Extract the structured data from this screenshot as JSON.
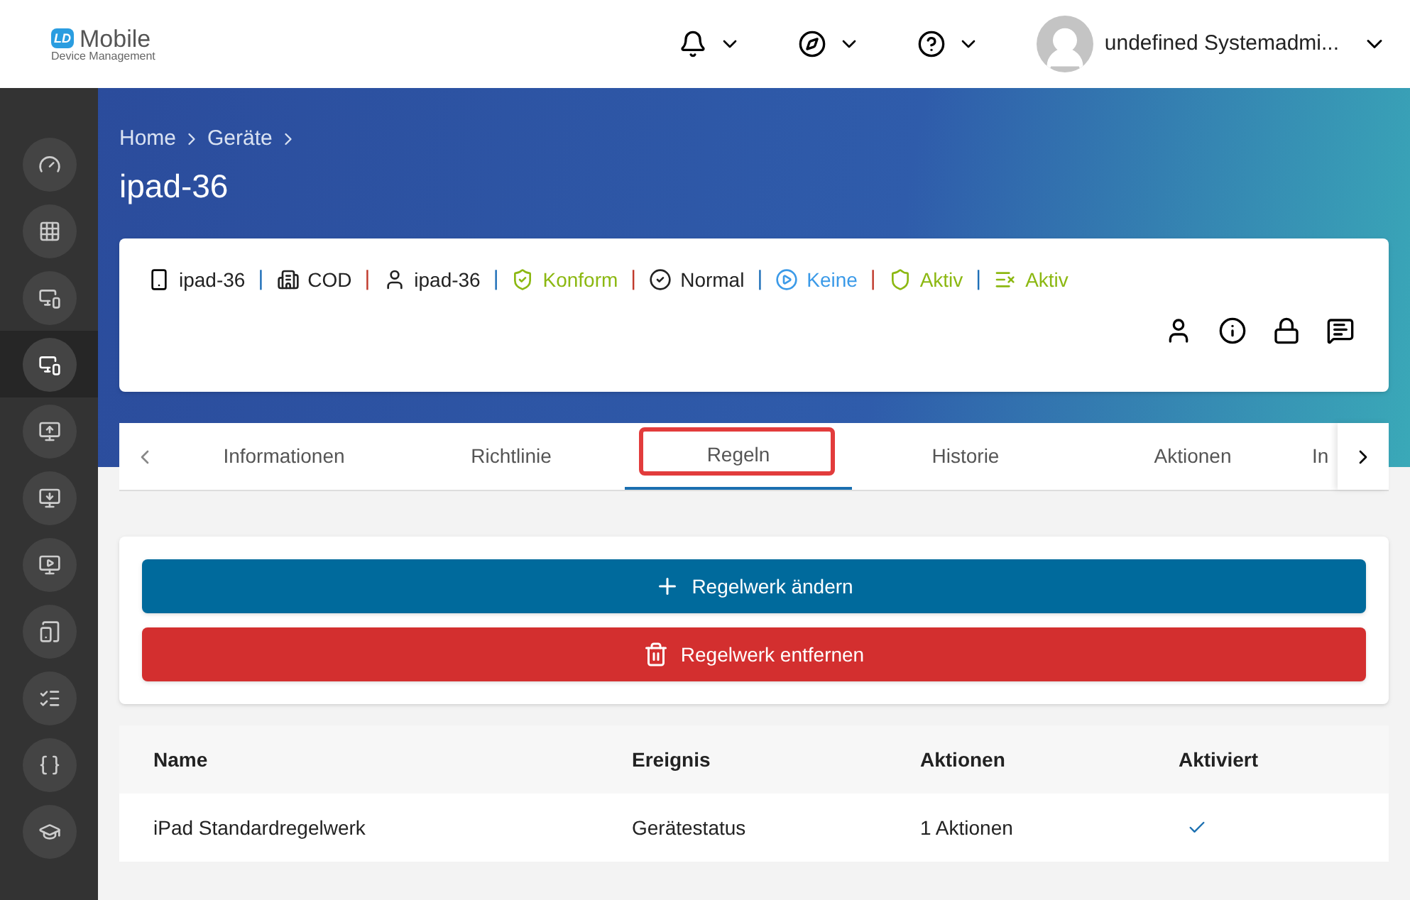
{
  "logo": {
    "mark": "LD",
    "title": "Mobile",
    "subtitle": "Device Management"
  },
  "topbar": {
    "user": "undefined Systemadmi..."
  },
  "sidebar": {
    "items": [
      {
        "kind": "gauge",
        "selected": false
      },
      {
        "kind": "grid",
        "selected": false
      },
      {
        "kind": "monitor-star",
        "selected": false
      },
      {
        "kind": "devices",
        "selected": true
      },
      {
        "kind": "monitor-plus-arrow",
        "selected": false
      },
      {
        "kind": "monitor-download",
        "selected": false
      },
      {
        "kind": "monitor-plus",
        "selected": false
      },
      {
        "kind": "phone-check",
        "selected": false
      },
      {
        "kind": "list-check",
        "selected": false
      },
      {
        "kind": "braces",
        "selected": false
      },
      {
        "kind": "graduation",
        "selected": false
      }
    ]
  },
  "breadcrumb": [
    "Home",
    "Geräte"
  ],
  "page_title": "ipad-36",
  "status": [
    {
      "kind": "phone",
      "text": "ipad-36",
      "color": "#222222"
    },
    {
      "kind": "separator",
      "text": "|",
      "color": "#1e6fb8"
    },
    {
      "kind": "building",
      "text": "COD",
      "color": "#222222"
    },
    {
      "kind": "separator",
      "text": "|",
      "color": "#c0392b"
    },
    {
      "kind": "person",
      "text": "ipad-36",
      "color": "#222222"
    },
    {
      "kind": "separator",
      "text": "|",
      "color": "#1e6fb8"
    },
    {
      "kind": "shield-check",
      "text": "Konform",
      "color": "#8cb812"
    },
    {
      "kind": "separator",
      "text": "|",
      "color": "#c0392b"
    },
    {
      "kind": "circle-check",
      "text": "Normal",
      "color": "#222222"
    },
    {
      "kind": "separator",
      "text": "|",
      "color": "#1e6fb8"
    },
    {
      "kind": "play",
      "text": "Keine",
      "color": "#3b9ae8"
    },
    {
      "kind": "separator",
      "text": "|",
      "color": "#c0392b"
    },
    {
      "kind": "shield",
      "text": "Aktiv",
      "color": "#8cb812"
    },
    {
      "kind": "separator",
      "text": "|",
      "color": "#1e6fb8"
    },
    {
      "kind": "list-x",
      "text": "Aktiv",
      "color": "#8cb812"
    }
  ],
  "tabs": [
    {
      "label": "Informationen",
      "selected": false
    },
    {
      "label": "Richtlinie",
      "selected": false
    },
    {
      "label": "Regeln",
      "selected": true
    },
    {
      "label": "Historie",
      "selected": false
    },
    {
      "label": "Aktionen",
      "selected": false
    },
    {
      "label": "In",
      "selected": false
    }
  ],
  "buttons": [
    {
      "kind": "add",
      "label": "Regelwerk ändern"
    },
    {
      "kind": "delete",
      "label": "Regelwerk entfernen"
    }
  ],
  "table": {
    "columns": [
      "Name",
      "Ereignis",
      "Aktionen",
      "Aktiviert"
    ],
    "rows": [
      {
        "name": "iPad Standardregelwerk",
        "event": "Gerätestatus",
        "actions": "1 Aktionen",
        "enabled": true
      }
    ]
  }
}
